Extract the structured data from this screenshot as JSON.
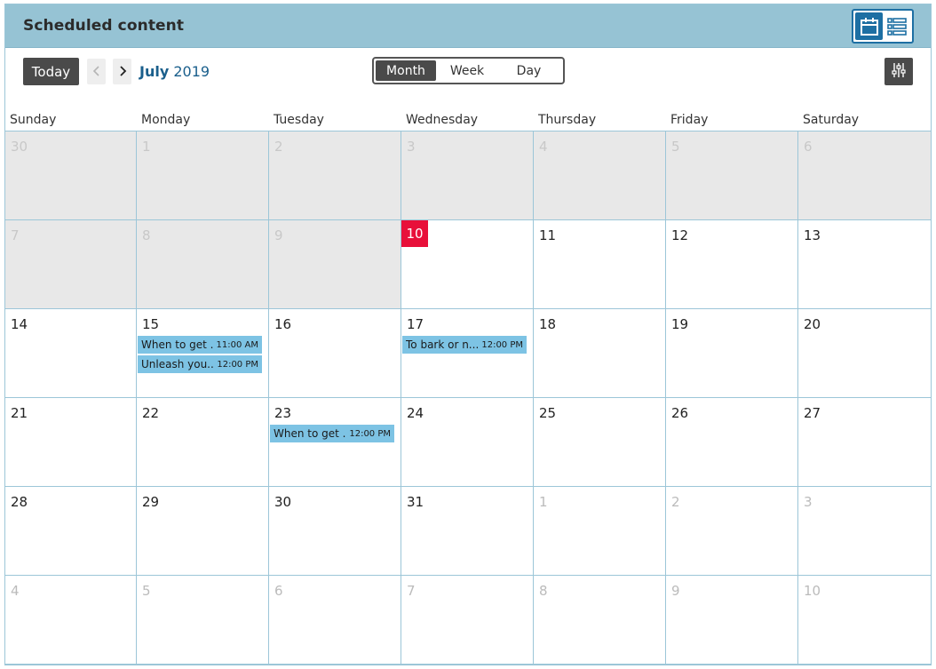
{
  "header": {
    "title": "Scheduled content",
    "view_switch": {
      "calendar_icon": "calendar-icon",
      "list_icon": "list-icon",
      "active": "calendar"
    }
  },
  "toolbar": {
    "today_label": "Today",
    "prev_icon": "chevron-left-icon",
    "next_icon": "chevron-right-icon",
    "month": "July",
    "year": "2019",
    "views": [
      "Month",
      "Week",
      "Day"
    ],
    "active_view": "Month",
    "filter_icon": "sliders-icon"
  },
  "weekdays": [
    "Sunday",
    "Monday",
    "Tuesday",
    "Wednesday",
    "Thursday",
    "Friday",
    "Saturday"
  ],
  "weeks": [
    [
      {
        "d": "30",
        "s": "past"
      },
      {
        "d": "1",
        "s": "past"
      },
      {
        "d": "2",
        "s": "past"
      },
      {
        "d": "3",
        "s": "past"
      },
      {
        "d": "4",
        "s": "past"
      },
      {
        "d": "5",
        "s": "past"
      },
      {
        "d": "6",
        "s": "past"
      }
    ],
    [
      {
        "d": "7",
        "s": "past"
      },
      {
        "d": "8",
        "s": "past"
      },
      {
        "d": "9",
        "s": "past"
      },
      {
        "d": "10",
        "s": "today"
      },
      {
        "d": "11",
        "s": "normal"
      },
      {
        "d": "12",
        "s": "normal"
      },
      {
        "d": "13",
        "s": "normal"
      }
    ],
    [
      {
        "d": "14",
        "s": "normal"
      },
      {
        "d": "15",
        "s": "normal"
      },
      {
        "d": "16",
        "s": "normal"
      },
      {
        "d": "17",
        "s": "normal"
      },
      {
        "d": "18",
        "s": "normal"
      },
      {
        "d": "19",
        "s": "normal"
      },
      {
        "d": "20",
        "s": "normal"
      }
    ],
    [
      {
        "d": "21",
        "s": "normal"
      },
      {
        "d": "22",
        "s": "normal"
      },
      {
        "d": "23",
        "s": "normal"
      },
      {
        "d": "24",
        "s": "normal"
      },
      {
        "d": "25",
        "s": "normal"
      },
      {
        "d": "26",
        "s": "normal"
      },
      {
        "d": "27",
        "s": "normal"
      }
    ],
    [
      {
        "d": "28",
        "s": "normal"
      },
      {
        "d": "29",
        "s": "normal"
      },
      {
        "d": "30",
        "s": "normal"
      },
      {
        "d": "31",
        "s": "normal"
      },
      {
        "d": "1",
        "s": "other"
      },
      {
        "d": "2",
        "s": "other"
      },
      {
        "d": "3",
        "s": "other"
      }
    ],
    [
      {
        "d": "4",
        "s": "other"
      },
      {
        "d": "5",
        "s": "other"
      },
      {
        "d": "6",
        "s": "other"
      },
      {
        "d": "7",
        "s": "other"
      },
      {
        "d": "8",
        "s": "other"
      },
      {
        "d": "9",
        "s": "other"
      },
      {
        "d": "10",
        "s": "other"
      }
    ]
  ],
  "events": [
    {
      "week": 2,
      "day": 1,
      "title": "When to get ...",
      "time": "11:00 AM"
    },
    {
      "week": 2,
      "day": 1,
      "title": "Unleash you...",
      "time": "12:00 PM"
    },
    {
      "week": 2,
      "day": 3,
      "title": "To bark or n...",
      "time": "12:00 PM"
    },
    {
      "week": 3,
      "day": 2,
      "title": "When to get ...",
      "time": "12:00 PM"
    }
  ],
  "colors": {
    "header_bg": "#96c3d4",
    "accent": "#1d6fa3",
    "today": "#e8103a",
    "event": "#7dc3e4",
    "grid_line": "#9cc6d8",
    "past_bg": "#e8e8e8"
  }
}
